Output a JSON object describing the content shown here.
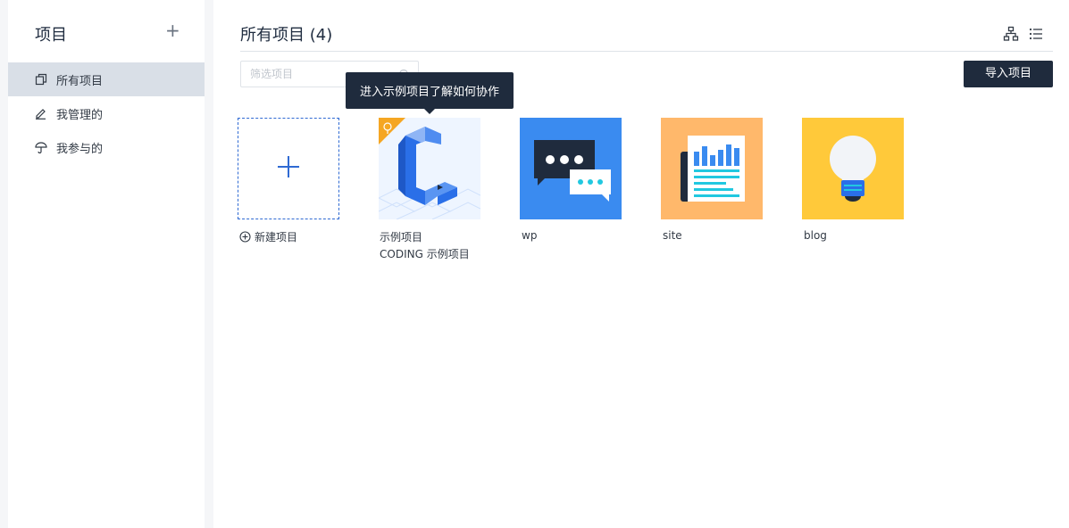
{
  "sidebar": {
    "title": "项目",
    "add_glyph": "+",
    "items": [
      {
        "label": "所有项目",
        "icon": "copy-icon",
        "active": true
      },
      {
        "label": "我管理的",
        "icon": "edit-icon",
        "active": false
      },
      {
        "label": "我参与的",
        "icon": "umbrella-icon",
        "active": false
      }
    ]
  },
  "main": {
    "title": "所有项目 (4)",
    "search": {
      "placeholder": "筛选项目",
      "value": ""
    },
    "import_label": "导入项目",
    "tooltip": "进入示例项目了解如何协作",
    "view_icons": [
      "tree-view-icon",
      "list-view-icon"
    ],
    "new_project_label": "新建项目",
    "projects": [
      {
        "name": "示例项目",
        "subtitle": "CODING 示例项目",
        "bg": "#e8f2ff",
        "icon": "coding-logo-icon"
      },
      {
        "name": "wp",
        "subtitle": "",
        "bg": "#3a8bf0",
        "icon": "chat-bubbles-icon"
      },
      {
        "name": "site",
        "subtitle": "",
        "bg": "#ffb86b",
        "icon": "newspaper-chart-icon"
      },
      {
        "name": "blog",
        "subtitle": "",
        "bg": "#ffc93a",
        "icon": "lightbulb-icon"
      }
    ]
  },
  "colors": {
    "accent": "#2f6ad3",
    "dark": "#1f2b3d",
    "sidebar_active": "#d9dfe7"
  }
}
